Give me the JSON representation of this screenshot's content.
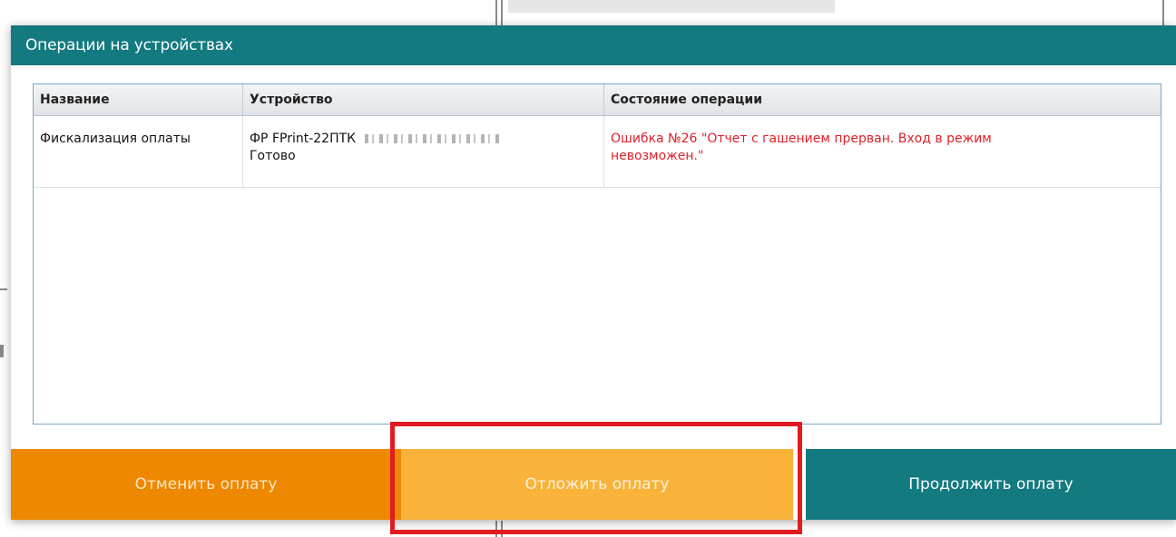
{
  "dialog": {
    "title": "Операции на устройствах"
  },
  "table": {
    "columns": [
      "Название",
      "Устройство",
      "Состояние операции"
    ],
    "rows": [
      {
        "name": "Фискализация оплаты",
        "device_line1": "ФР FPrint-22ПТК",
        "device_line2": "Готово",
        "status": "Ошибка №26 \"Отчет с гашением прерван. Вход в режим невозможен.\""
      }
    ]
  },
  "buttons": {
    "cancel_label": "Отменить оплату",
    "postpone_label": "Отложить оплату",
    "continue_label": "Продолжить оплату"
  },
  "colors": {
    "header_teal": "#137a80",
    "cancel_orange": "#ee8800",
    "postpone_orange": "#f9b33b",
    "error_red": "#e0202a",
    "highlight_red": "#e11b22"
  }
}
